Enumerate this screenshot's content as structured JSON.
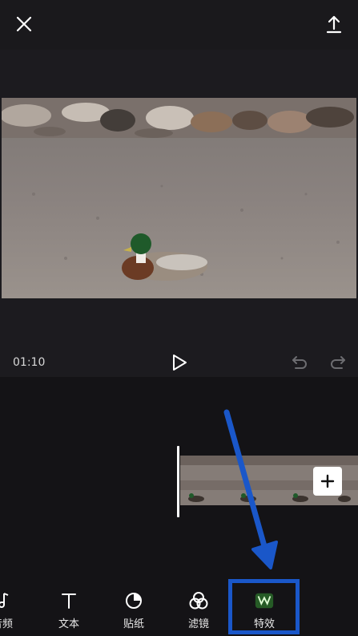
{
  "player": {
    "timecode": "01:10"
  },
  "toolbar": {
    "items": [
      {
        "label": "音频",
        "icon": "music-note-icon"
      },
      {
        "label": "文本",
        "icon": "text-icon"
      },
      {
        "label": "贴纸",
        "icon": "sticker-icon"
      },
      {
        "label": "滤镜",
        "icon": "filter-icon"
      },
      {
        "label": "特效",
        "icon": "effects-icon"
      }
    ]
  },
  "colors": {
    "highlight": "#1a57c9",
    "background": "#141316"
  }
}
